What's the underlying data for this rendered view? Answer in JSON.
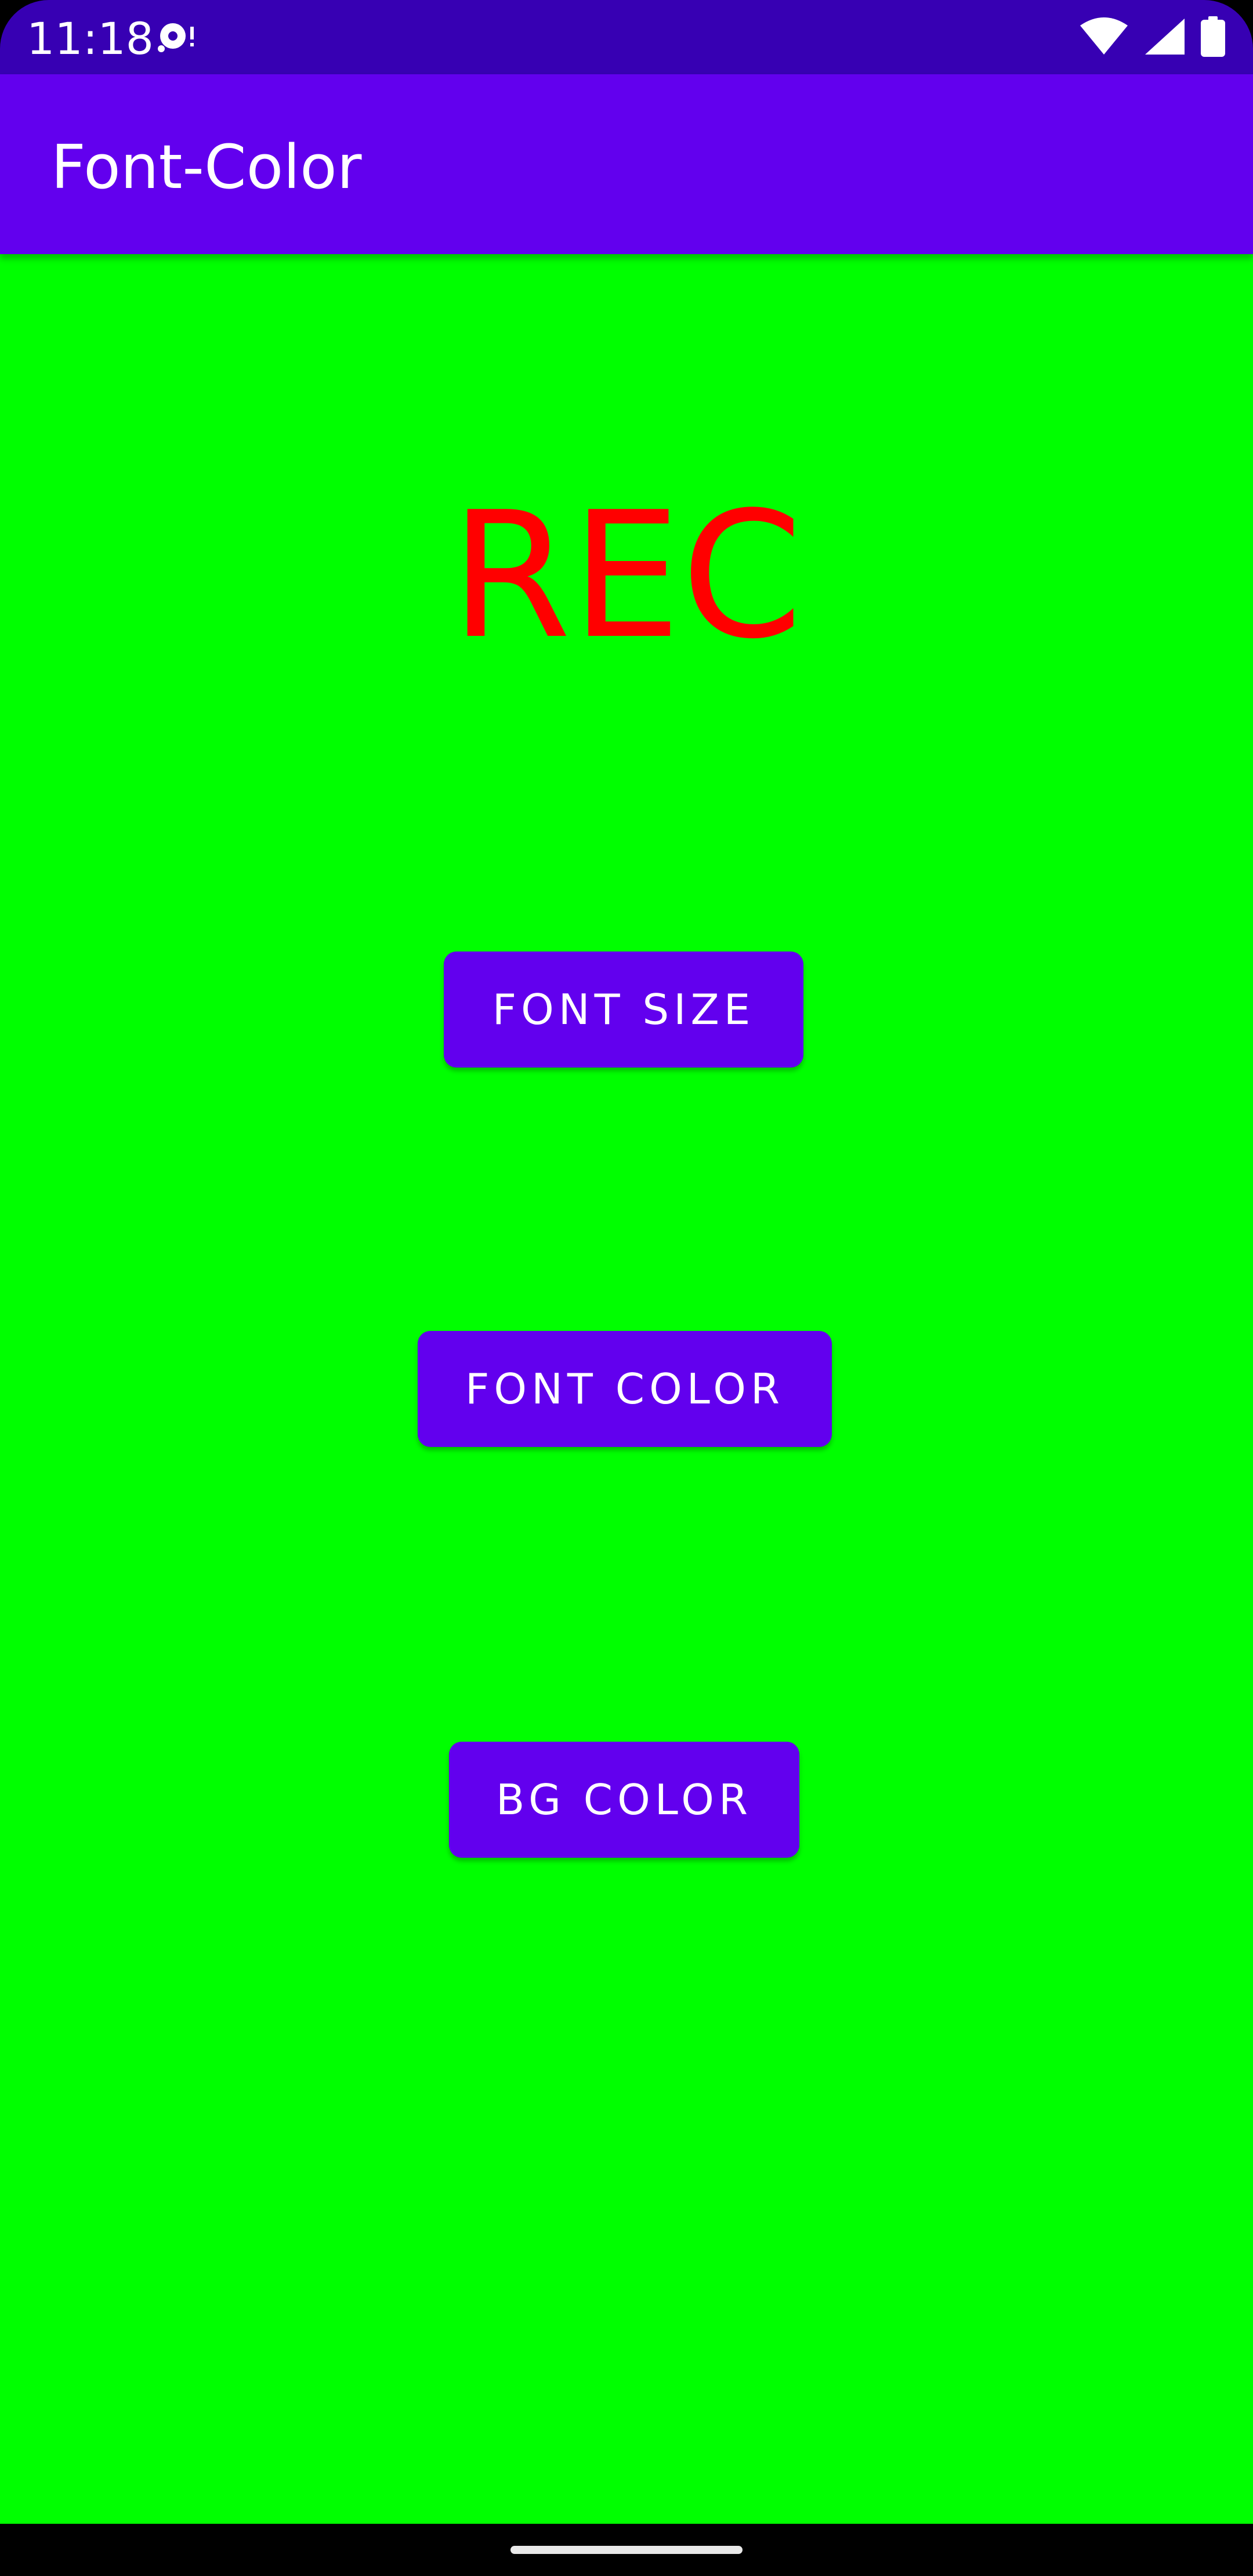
{
  "status_bar": {
    "time": "11:18",
    "icons": [
      "media-notification-icon",
      "wifi-icon",
      "cellular-signal-icon",
      "battery-icon"
    ]
  },
  "app_bar": {
    "title": "Font-Color"
  },
  "main": {
    "display_text": "REC",
    "display_text_color": "#FF0000",
    "background_color": "#00FF00",
    "buttons": {
      "font_size": "FONT SIZE",
      "font_color": "FONT COLOR",
      "bg_color": "BG COLOR"
    }
  },
  "colors": {
    "status_bar": "#3700B3",
    "app_bar": "#6200EE",
    "button": "#6200EE"
  }
}
